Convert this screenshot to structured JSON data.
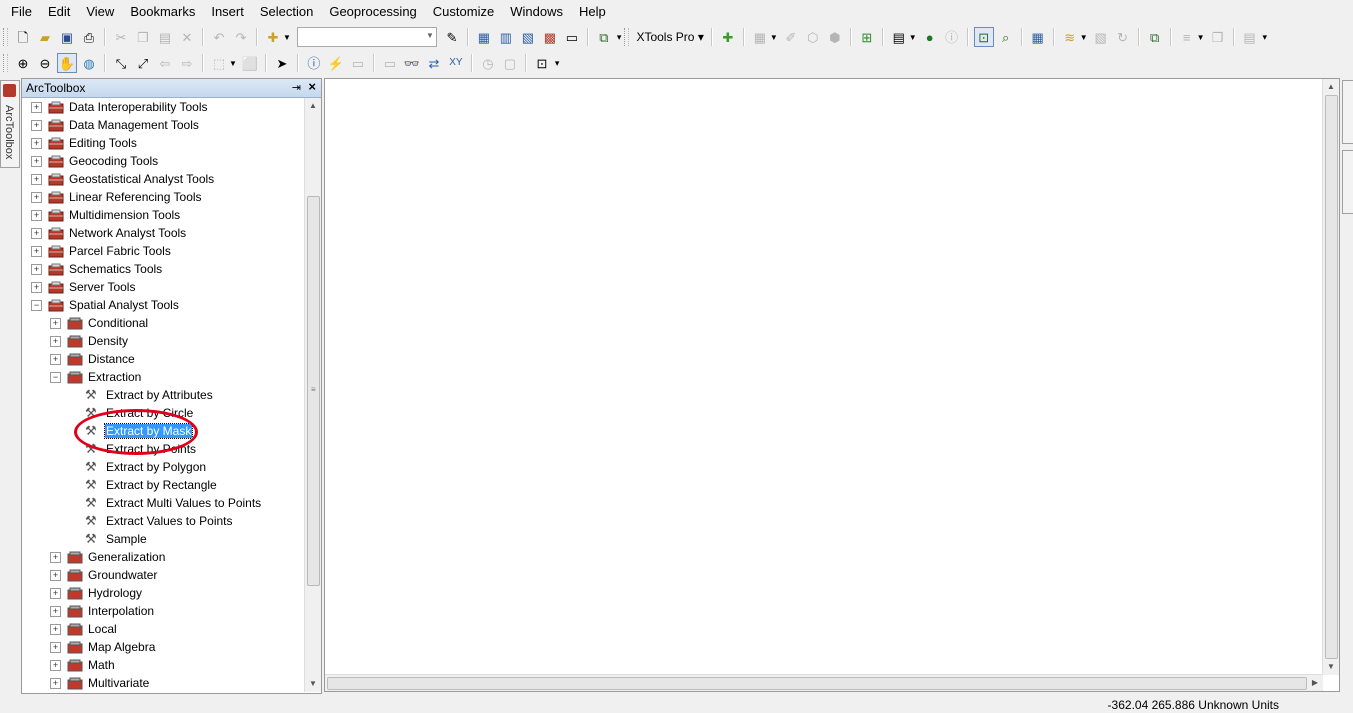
{
  "menu": [
    "File",
    "Edit",
    "View",
    "Bookmarks",
    "Insert",
    "Selection",
    "Geoprocessing",
    "Customize",
    "Windows",
    "Help"
  ],
  "toolbar": {
    "scale_value": "",
    "xtools_label": "XTools Pro"
  },
  "left_tab": {
    "label": "ArcToolbox"
  },
  "toolbox": {
    "title": "ArcToolbox",
    "toolboxes": [
      "Data Interoperability Tools",
      "Data Management Tools",
      "Editing Tools",
      "Geocoding Tools",
      "Geostatistical Analyst Tools",
      "Linear Referencing Tools",
      "Multidimension Tools",
      "Network Analyst Tools",
      "Parcel Fabric Tools",
      "Schematics Tools",
      "Server Tools",
      "Spatial Analyst Tools"
    ],
    "spatial_toolsets_before": [
      "Conditional",
      "Density",
      "Distance",
      "Extraction"
    ],
    "extraction_tools": [
      "Extract by Attributes",
      "Extract by Circle",
      "Extract by Mask",
      "Extract by Points",
      "Extract by Polygon",
      "Extract by Rectangle",
      "Extract Multi Values to Points",
      "Extract Values to Points",
      "Sample"
    ],
    "selected_tool": "Extract by Mask",
    "spatial_toolsets_after": [
      "Generalization",
      "Groundwater",
      "Hydrology",
      "Interpolation",
      "Local",
      "Map Algebra",
      "Math",
      "Multivariate"
    ]
  },
  "status": {
    "coordinates": "-362.04  265.886 Unknown Units"
  },
  "colors": {
    "selection": "#3399ff",
    "highlight_circle": "#e0001a",
    "toolbox_icon": "#b33a2a"
  }
}
